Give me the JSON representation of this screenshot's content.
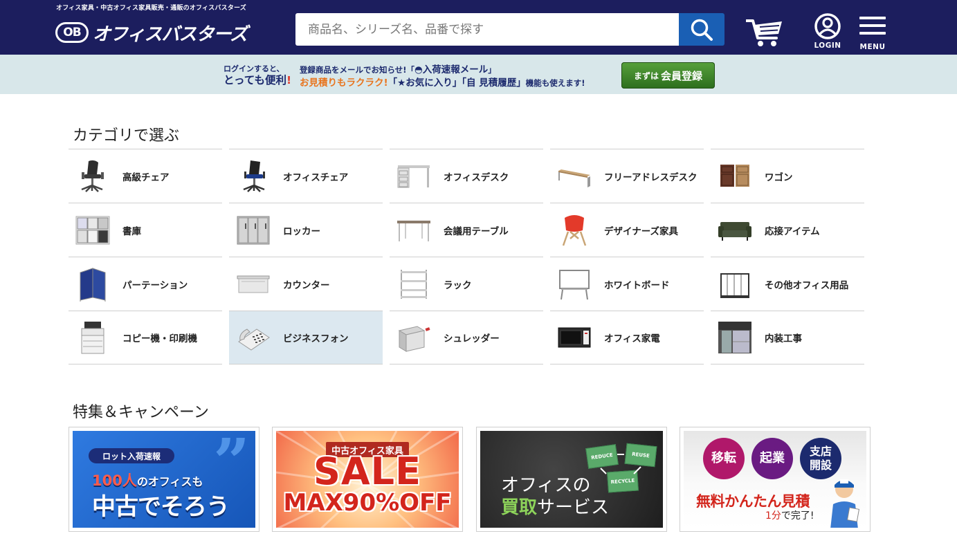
{
  "header": {
    "tagline": "オフィス家具・中古オフィス家具販売・通販のオフィスバスターズ",
    "logo_mark": "OB",
    "logo_text": "オフィスバスターズ",
    "search_placeholder": "商品名、シリーズ名、品番で探す",
    "login_label": "LOGIN",
    "menu_label": "MENU",
    "colors": {
      "header_bg": "#1c1e5e",
      "search_button": "#1a5fb4"
    }
  },
  "promo": {
    "left_line1": "ログインすると、",
    "left_line2_normal": "とっても便利",
    "left_line2_mark": "!",
    "row1_prefix": "登録商品をメールでお知らせ!「",
    "row1_highlight": "入荷速報メール",
    "row1_suffix": "」",
    "row2_orange": "お見積りもラクラク!",
    "row2_fav": "「★お気に入り」",
    "row2_hist": "「自 見積履歴」",
    "row2_suffix": "機能も使えます!",
    "register_small": "まずは",
    "register_large": "会員登録",
    "colors": {
      "promo_bg": "#d8e7ea",
      "register_button": "#3c8a2a"
    }
  },
  "categories": {
    "title": "カテゴリで選ぶ",
    "items": [
      {
        "label": "高級チェア",
        "icon": "executive-chair"
      },
      {
        "label": "オフィスチェア",
        "icon": "office-chair"
      },
      {
        "label": "オフィスデスク",
        "icon": "office-desk"
      },
      {
        "label": "フリーアドレスデスク",
        "icon": "free-address-desk"
      },
      {
        "label": "ワゴン",
        "icon": "wagon"
      },
      {
        "label": "書庫",
        "icon": "bookcase"
      },
      {
        "label": "ロッカー",
        "icon": "locker"
      },
      {
        "label": "会議用テーブル",
        "icon": "meeting-table"
      },
      {
        "label": "デザイナーズ家具",
        "icon": "designer-chair"
      },
      {
        "label": "応接アイテム",
        "icon": "sofa"
      },
      {
        "label": "パーテーション",
        "icon": "partition"
      },
      {
        "label": "カウンター",
        "icon": "counter"
      },
      {
        "label": "ラック",
        "icon": "rack"
      },
      {
        "label": "ホワイトボード",
        "icon": "whiteboard"
      },
      {
        "label": "その他オフィス用品",
        "icon": "umbrella-stand"
      },
      {
        "label": "コピー機・印刷機",
        "icon": "copier"
      },
      {
        "label": "ビジネスフォン",
        "icon": "business-phone"
      },
      {
        "label": "シュレッダー",
        "icon": "shredder"
      },
      {
        "label": "オフィス家電",
        "icon": "microwave"
      },
      {
        "label": "内装工事",
        "icon": "interior-work"
      }
    ],
    "active_item": "ビジネスフォン"
  },
  "campaigns": {
    "title": "特集＆キャンペーン",
    "banners": [
      {
        "tag": "ロット入荷速報",
        "line1_red": "100人",
        "line1_rest": "のオフィスも",
        "line2": "中古でそろう"
      },
      {
        "tag": "中古オフィス家具",
        "sale": "SALE",
        "max": "MAX90%OFF"
      },
      {
        "line1": "オフィスの",
        "line2_green": "買取",
        "line2_rest": "サービス",
        "cards": [
          "REDUCE",
          "REUSE",
          "RECYCLE"
        ]
      },
      {
        "circles": [
          "移転",
          "起業",
          "支店開設"
        ],
        "main": "無料かんたん見積",
        "sub_red": "1分",
        "sub_rest": "で完了!"
      }
    ]
  }
}
